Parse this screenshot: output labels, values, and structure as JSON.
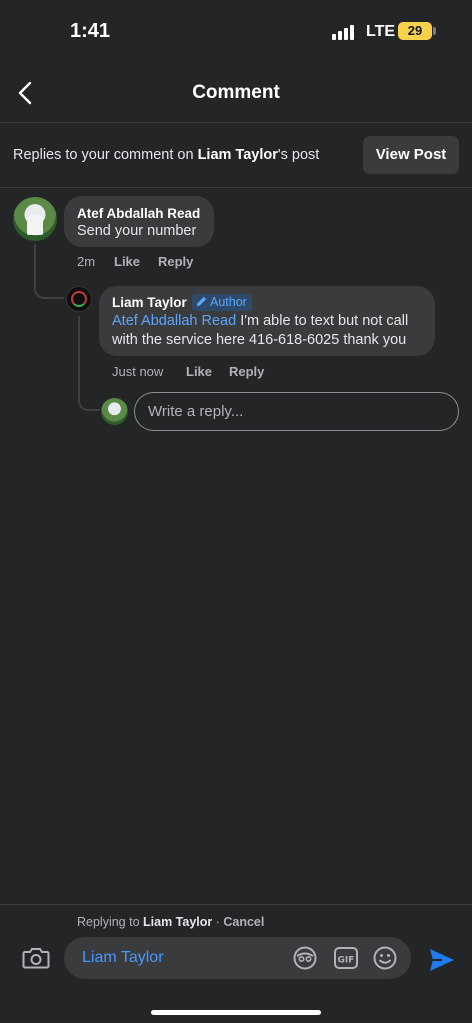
{
  "status_bar": {
    "time": "1:41",
    "network": "LTE",
    "battery": "29"
  },
  "header": {
    "title": "Comment"
  },
  "notice": {
    "prefix": "Replies to your comment on ",
    "post_owner": "Liam Taylor",
    "suffix": "'s post",
    "view_post_label": "View Post"
  },
  "comments": [
    {
      "author": "Atef Abdallah Read",
      "text": "Send your number",
      "timestamp": "2m",
      "like_label": "Like",
      "reply_label": "Reply"
    },
    {
      "author": "Liam Taylor",
      "badge": "Author",
      "mention": "Atef Abdallah Read",
      "text_line1_rest": "I'm able to text but not call",
      "text_line2": "with the service here 416-618-6025 thank you",
      "timestamp": "Just now",
      "like_label": "Like",
      "reply_label": "Reply"
    }
  ],
  "reply_input": {
    "placeholder": "Write a reply..."
  },
  "composer": {
    "replying_prefix": "Replying to ",
    "replying_to": "Liam Taylor",
    "separator": " · ",
    "cancel_label": "Cancel",
    "input_value": "Liam Taylor"
  },
  "colors": {
    "accent": "#4599ff",
    "background": "#242526",
    "bubble": "#3a3b3c",
    "badge_bg": "#2e4a6b"
  },
  "icons": [
    "back-icon",
    "camera-icon",
    "sticker-icon",
    "gif-icon",
    "emoji-icon",
    "send-icon",
    "pencil-icon"
  ]
}
